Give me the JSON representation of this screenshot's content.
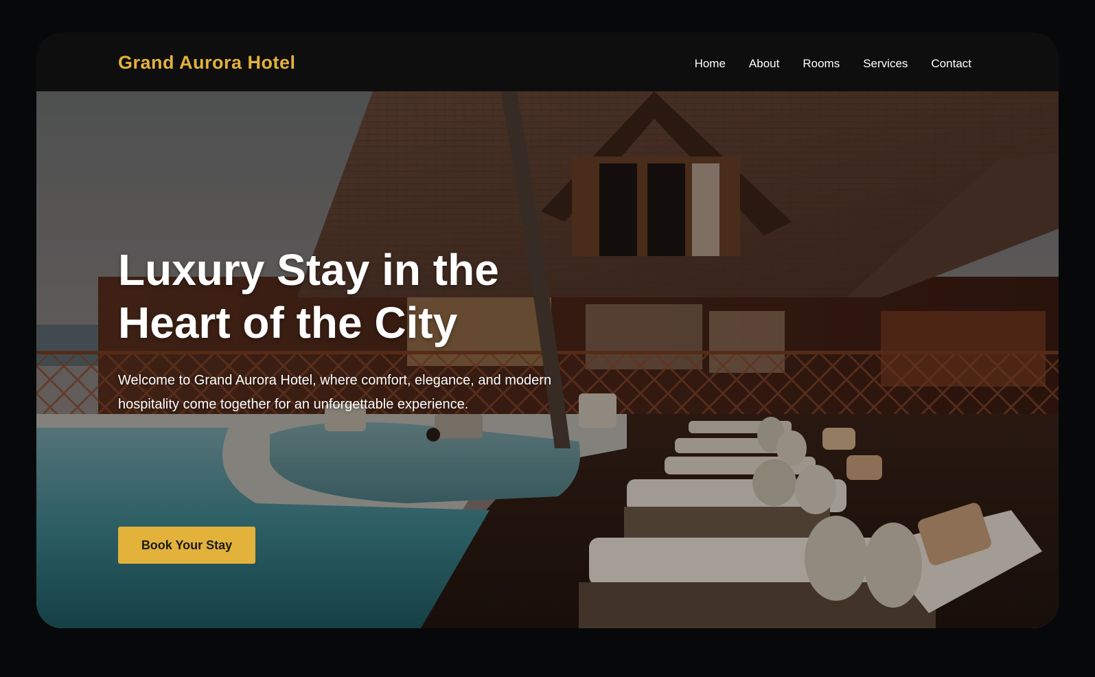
{
  "brand": {
    "name": "Grand Aurora Hotel",
    "color": "#e3b23c"
  },
  "nav": {
    "items": [
      {
        "label": "Home"
      },
      {
        "label": "About"
      },
      {
        "label": "Rooms"
      },
      {
        "label": "Services"
      },
      {
        "label": "Contact"
      }
    ]
  },
  "hero": {
    "title_line1": "Luxury Stay in the",
    "title_line2": "Heart of the City",
    "subtitle": "Welcome to Grand Aurora Hotel, where comfort, elegance, and modern hospitality come together for an unforgettable experience.",
    "cta_label": "Book Your Stay",
    "cta_color": "#e2b23a"
  }
}
